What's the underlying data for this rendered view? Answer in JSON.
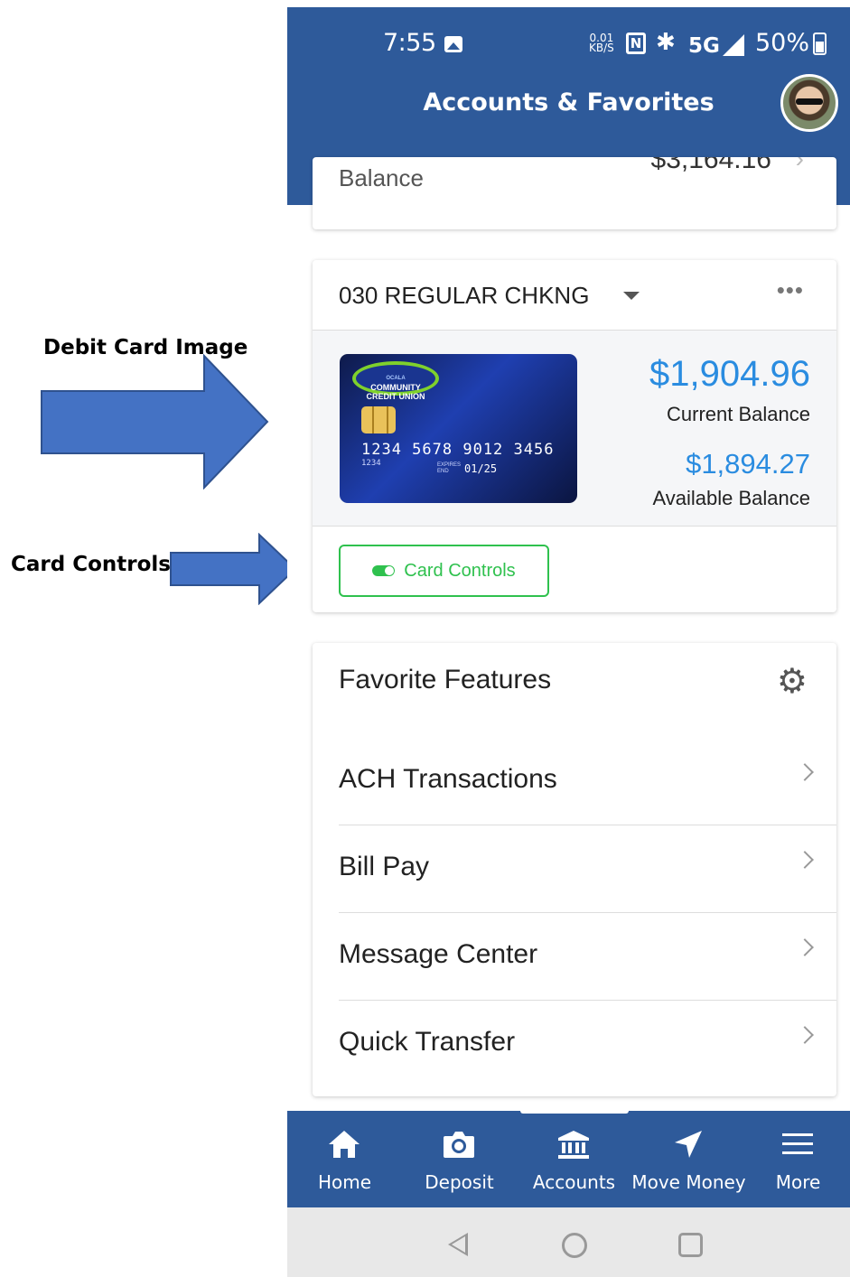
{
  "annotations": {
    "debit_card_label": "Debit Card Image",
    "card_controls_label": "Card Controls",
    "arrow_color": "#4472c4"
  },
  "status_bar": {
    "time": "7:55",
    "speed": "0.01",
    "speed_unit": "KB/S",
    "nfc": "N",
    "network": "5G",
    "battery": "50%"
  },
  "header": {
    "title": "Accounts & Favorites"
  },
  "colors": {
    "primary": "#2e5a9a",
    "accent_blue": "#2a8ce0",
    "success_green": "#2fc14e"
  },
  "prev_account": {
    "balance_label": "Balance",
    "balance_value": "$3,164.16"
  },
  "account": {
    "name": "030 REGULAR CHKNG",
    "menu": "•••",
    "card": {
      "logo_line1": "OCALA",
      "logo_line2": "COMMUNITY",
      "logo_line3": "CREDIT UNION",
      "number": "1234 5678 9012 3456",
      "number_small": "1234",
      "expires_label": "EXPIRES END",
      "expiry": "01/25"
    },
    "current_balance": "$1,904.96",
    "current_balance_label": "Current Balance",
    "available_balance": "$1,894.27",
    "available_balance_label": "Available Balance",
    "card_controls_button": "Card Controls"
  },
  "favorites": {
    "title": "Favorite Features",
    "items": [
      {
        "label": "ACH Transactions"
      },
      {
        "label": "Bill Pay"
      },
      {
        "label": "Message Center"
      },
      {
        "label": "Quick Transfer"
      }
    ]
  },
  "tabs": [
    {
      "label": "Home",
      "icon": "home-icon"
    },
    {
      "label": "Deposit",
      "icon": "camera-icon"
    },
    {
      "label": "Accounts",
      "icon": "bank-icon"
    },
    {
      "label": "Move Money",
      "icon": "send-icon"
    },
    {
      "label": "More",
      "icon": "menu-icon"
    }
  ]
}
